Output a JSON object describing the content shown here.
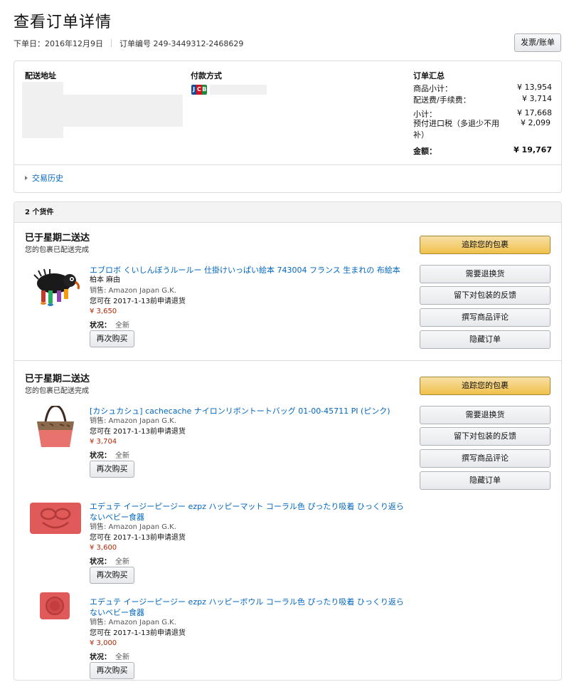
{
  "header": {
    "title": "查看订单详情",
    "order_date": "下单日：2016年12月9日",
    "order_number": "订单编号 249-3449312-2468629",
    "invoice_button": "发票/账单"
  },
  "summary": {
    "shipping_address_label": "配送地址",
    "payment_label": "付款方式",
    "payment_card_icon": "jcb-card-icon",
    "order_summary_label": "订单汇总",
    "rows": [
      {
        "label": "商品小计：",
        "value": "¥ 13,954"
      },
      {
        "label": "配送费/手续费：",
        "value": "¥ 3,714"
      },
      {
        "label": "小计：",
        "value": "¥ 17,668"
      },
      {
        "label": "预付进口税（多退少不用补）",
        "value": "¥ 2,099"
      },
      {
        "label": "金额：",
        "value": "¥ 19,767"
      }
    ],
    "history_link": "交易历史"
  },
  "shipments": {
    "count_label": "2 个货件",
    "list": [
      {
        "status": "已于星期二送达",
        "sub": "您的包裹已配送完成",
        "buttons": {
          "track": "追踪您的包裹",
          "return": "需要退换货",
          "feedback": "留下对包装的反馈",
          "review": "撰写商品评论",
          "hide": "隐藏订单"
        },
        "items": [
          {
            "title": "エブロボ くいしんぼうルールー 仕掛けいっぱい絵本 743004 フランス 生まれの 布絵本",
            "author": "柏本 麻由",
            "seller": "销售: Amazon Japan G.K.",
            "return_by": "您可在 2017-1-13前申请退货",
            "price": "¥ 3,650",
            "condition_label": "状况：",
            "condition": "全新",
            "rebuy": "再次购买"
          }
        ]
      },
      {
        "status": "已于星期二送达",
        "sub": "您的包裹已配送完成",
        "buttons": {
          "track": "追踪您的包裹",
          "return": "需要退换货",
          "feedback": "留下对包装的反馈",
          "review": "撰写商品评论",
          "hide": "隐藏订单"
        },
        "items": [
          {
            "title": "[カシュカシュ] cachecache ナイロンリボントートバッグ 01-00-45711 PI (ピンク)",
            "seller": "销售: Amazon Japan G.K.",
            "return_by": "您可在 2017-1-13前申请退货",
            "price": "¥ 3,704",
            "condition_label": "状况：",
            "condition": "全新",
            "rebuy": "再次购买"
          },
          {
            "title": "エデュテ イージーピージー ezpz ハッピーマット コーラル色 ぴったり吸着 ひっくり返らないベビー食器",
            "seller": "销售: Amazon Japan G.K.",
            "return_by": "您可在 2017-1-13前申请退货",
            "price": "¥ 3,600",
            "condition_label": "状况：",
            "condition": "全新",
            "rebuy": "再次购买"
          },
          {
            "title": "エデュテ イージーピージー ezpz ハッピーボウル コーラル色 ぴったり吸着 ひっくり返らないベビー食器",
            "seller": "销售: Amazon Japan G.K.",
            "return_by": "您可在 2017-1-13前申请退货",
            "price": "¥ 3,000",
            "condition_label": "状况：",
            "condition": "全新",
            "rebuy": "再次购买"
          }
        ]
      }
    ]
  },
  "colors": {
    "link": "#0066c0",
    "price": "#b12704",
    "track_button": "#f0c14b"
  }
}
